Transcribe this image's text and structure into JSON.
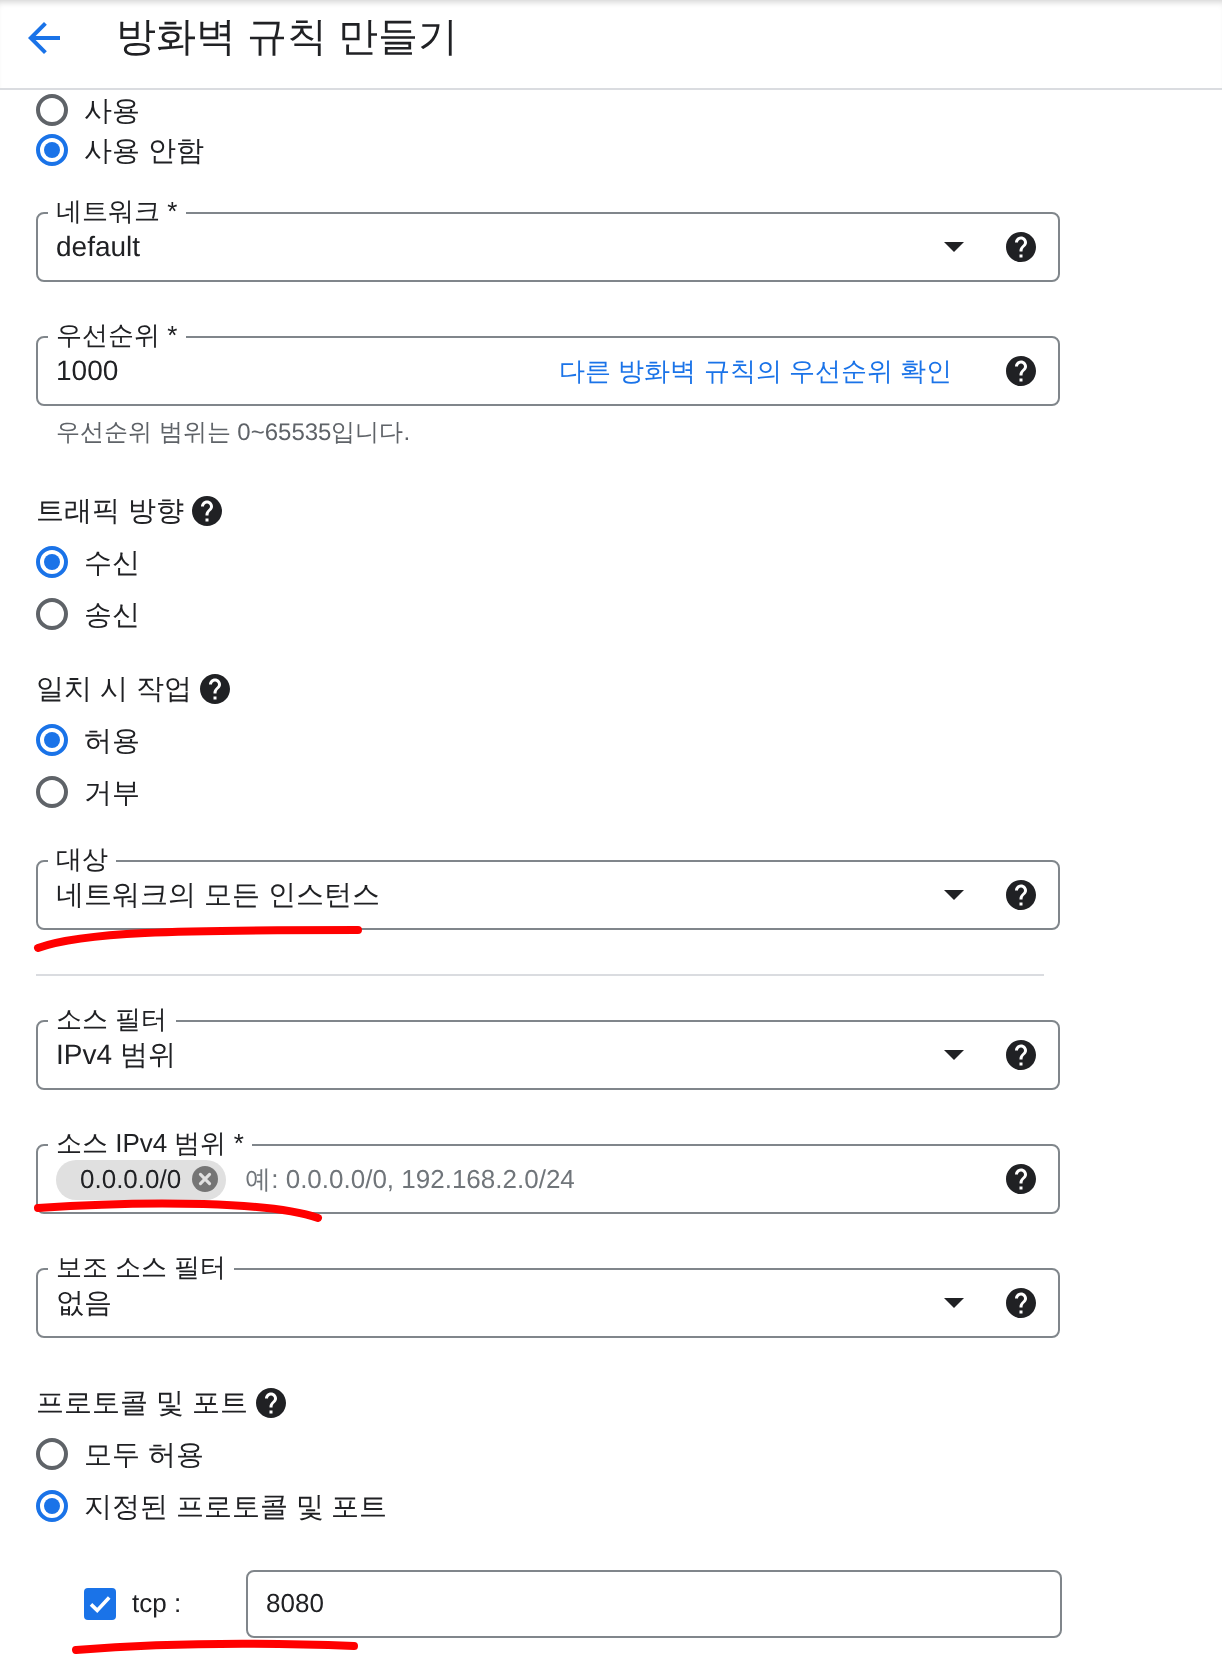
{
  "header": {
    "title": "방화벽 규칙 만들기"
  },
  "sections": [
    {
      "kind": "radio_group",
      "options": [
        {
          "label": "사용",
          "selected": false
        },
        {
          "label": "사용 안함",
          "selected": true
        }
      ]
    },
    {
      "kind": "select",
      "label": "네트워크 *",
      "value": "default",
      "help": true
    },
    {
      "kind": "text_input",
      "label": "우선순위 *",
      "value": "1000",
      "link": "다른 방화벽 규칙의 우선순위 확인",
      "help": true,
      "helper": "우선순위 범위는 0~65535입니다."
    },
    {
      "kind": "radio_group",
      "title": "트래픽 방향",
      "help": true,
      "options": [
        {
          "label": "수신",
          "selected": true
        },
        {
          "label": "송신",
          "selected": false
        }
      ]
    },
    {
      "kind": "radio_group",
      "title": "일치 시 작업",
      "help": true,
      "options": [
        {
          "label": "허용",
          "selected": true
        },
        {
          "label": "거부",
          "selected": false
        }
      ]
    },
    {
      "kind": "select",
      "label": "대상",
      "value": "네트워크의 모든 인스턴스",
      "help": true,
      "marked": true
    },
    {
      "kind": "divider"
    },
    {
      "kind": "select",
      "label": "소스 필터",
      "value": "IPv4 범위",
      "help": true
    },
    {
      "kind": "chips_input",
      "label": "소스 IPv4 범위 *",
      "chips": [
        {
          "label": "0.0.0.0/0",
          "marked": true
        }
      ],
      "placeholder": "예: 0.0.0.0/0, 192.168.2.0/24",
      "help": true
    },
    {
      "kind": "select",
      "label": "보조 소스 필터",
      "value": "없음",
      "help": true
    },
    {
      "kind": "radio_group",
      "title": "프로토콜 및 포트",
      "help": true,
      "options": [
        {
          "label": "모두 허용",
          "selected": false
        },
        {
          "label": "지정된 프로토콜 및 포트",
          "selected": true
        }
      ]
    },
    {
      "kind": "protocol_port",
      "protocol": "tcp :",
      "checked": true,
      "value": "8080",
      "marked": true
    }
  ]
}
